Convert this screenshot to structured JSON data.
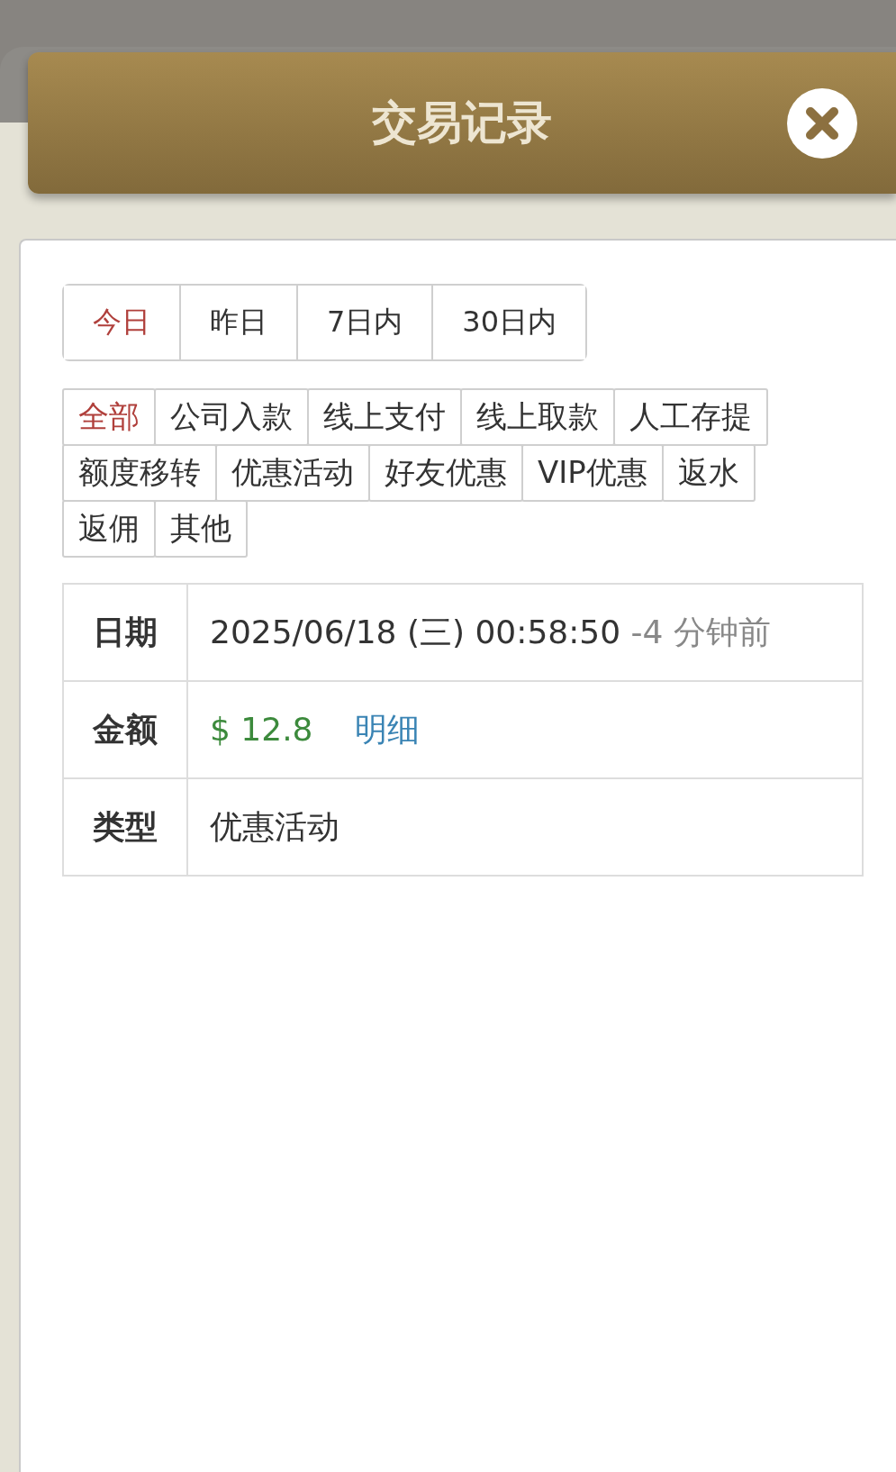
{
  "header": {
    "title": "交易记录"
  },
  "date_tabs": [
    {
      "label": "今日",
      "selected": true
    },
    {
      "label": "昨日",
      "selected": false
    },
    {
      "label": "7日内",
      "selected": false
    },
    {
      "label": "30日内",
      "selected": false
    }
  ],
  "type_filters": [
    {
      "label": "全部",
      "selected": true
    },
    {
      "label": "公司入款",
      "selected": false
    },
    {
      "label": "线上支付",
      "selected": false
    },
    {
      "label": "线上取款",
      "selected": false
    },
    {
      "label": "人工存提",
      "selected": false
    },
    {
      "label": "额度移转",
      "selected": false
    },
    {
      "label": "优惠活动",
      "selected": false
    },
    {
      "label": "好友优惠",
      "selected": false
    },
    {
      "label": "VIP优惠",
      "selected": false
    },
    {
      "label": "返水",
      "selected": false
    },
    {
      "label": "返佣",
      "selected": false
    },
    {
      "label": "其他",
      "selected": false
    }
  ],
  "details": [
    {
      "kind": "date",
      "label": "日期",
      "value": "2025/06/18 (三) 00:58:50",
      "relative": "-4 分钟前"
    },
    {
      "kind": "amount",
      "label": "金额",
      "value": "$ 12.8",
      "link": "明细"
    },
    {
      "kind": "text",
      "label": "类型",
      "value": "优惠活动"
    }
  ]
}
